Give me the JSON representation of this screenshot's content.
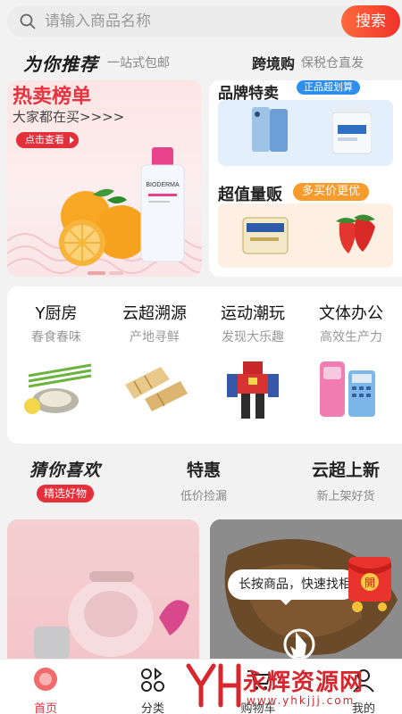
{
  "search": {
    "placeholder": "请输入商品名称",
    "button_label": "搜索"
  },
  "header": {
    "recommend_title": "为你推荐",
    "recommend_sub": "一站式包邮",
    "cross_title": "跨境购",
    "cross_sub": "保税仓直发"
  },
  "hot_sale": {
    "title": "热卖榜单",
    "subtitle": "大家都在买>>>>",
    "button": "点击查看",
    "bottle_brand": "BIODERMA"
  },
  "brand": {
    "title": "品牌特卖",
    "badge": "正品超划算"
  },
  "value_pack": {
    "title": "超值量贩",
    "badge": "多买价更优"
  },
  "categories": [
    {
      "name": "Y厨房",
      "sub": "春食春味"
    },
    {
      "name": "云超溯源",
      "sub": "产地寻鲜"
    },
    {
      "name": "运动潮玩",
      "sub": "发现大乐趣"
    },
    {
      "name": "文体办公",
      "sub": "高效生产力"
    }
  ],
  "tabs": [
    {
      "title": "猜你喜欢",
      "sub": "精选好物"
    },
    {
      "title": "特惠",
      "sub": "低价捡漏"
    },
    {
      "title": "云超上新",
      "sub": "新上架好货"
    }
  ],
  "tooltip": "长按商品，快速找相",
  "redpack_label": "開",
  "nav": [
    {
      "label": "首页",
      "icon": "home-icon"
    },
    {
      "label": "分类",
      "icon": "category-icon"
    },
    {
      "label": "购物车",
      "icon": "cart-icon"
    },
    {
      "label": "我的",
      "icon": "profile-icon"
    }
  ],
  "watermark": {
    "text": "永辉资源网",
    "url": "www.yhkjjj.com"
  },
  "colors": {
    "accent": "#e62f3b",
    "search_button": "#f0312a",
    "brand_badge": "#2d8ef0",
    "value_badge": "#f79b2c"
  }
}
